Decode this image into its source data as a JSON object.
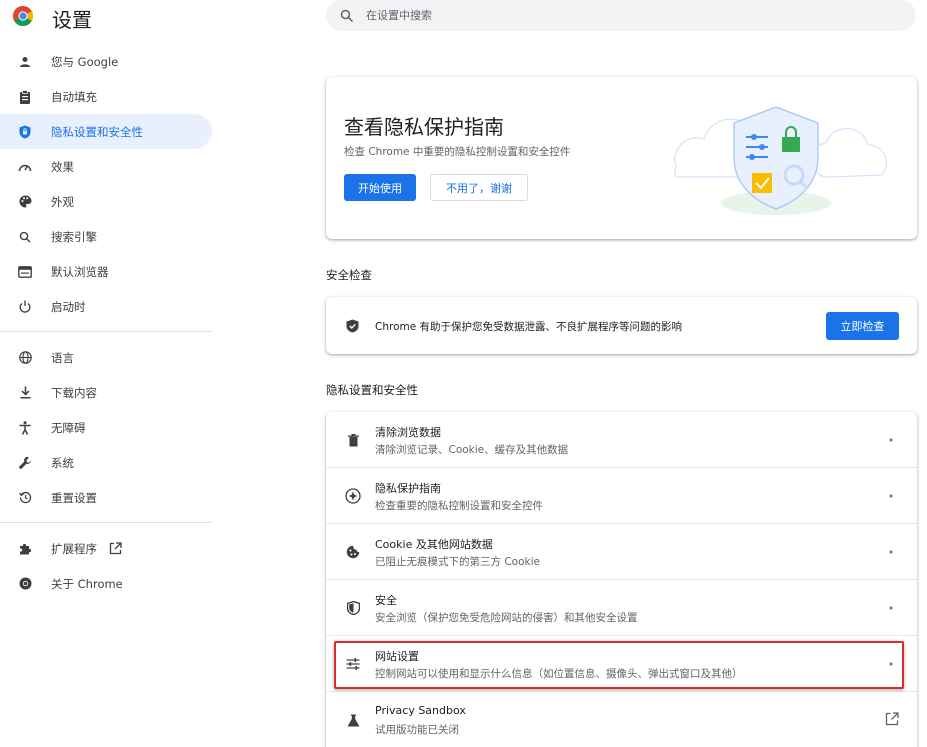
{
  "header": {
    "title": "设置",
    "search_placeholder": "在设置中搜索"
  },
  "sidebar": {
    "items": [
      {
        "label": "您与 Google",
        "icon": "person-icon"
      },
      {
        "label": "自动填充",
        "icon": "clipboard-icon"
      },
      {
        "label": "隐私设置和安全性",
        "icon": "shield-icon",
        "active": true
      },
      {
        "label": "效果",
        "icon": "speedometer-icon"
      },
      {
        "label": "外观",
        "icon": "palette-icon"
      },
      {
        "label": "搜索引擎",
        "icon": "search-icon"
      },
      {
        "label": "默认浏览器",
        "icon": "browser-window-icon"
      },
      {
        "label": "启动时",
        "icon": "power-icon"
      },
      {
        "label": "语言",
        "icon": "globe-icon"
      },
      {
        "label": "下载内容",
        "icon": "download-icon"
      },
      {
        "label": "无障碍",
        "icon": "accessibility-icon"
      },
      {
        "label": "系统",
        "icon": "wrench-icon"
      },
      {
        "label": "重置设置",
        "icon": "reset-history-icon"
      },
      {
        "label": "扩展程序",
        "icon": "puzzle-icon"
      },
      {
        "label": "关于 Chrome",
        "icon": "chrome-icon"
      }
    ]
  },
  "promo": {
    "title": "查看隐私保护指南",
    "subtitle": "检查 Chrome 中重要的隐私控制设置和安全控件",
    "primary_button": "开始使用",
    "secondary_button": "不用了，谢谢"
  },
  "safety_check": {
    "section_title": "安全检查",
    "text": "Chrome 有助于保护您免受数据泄露、不良扩展程序等问题的影响",
    "button": "立即检查"
  },
  "privacy": {
    "section_title": "隐私设置和安全性",
    "rows": [
      {
        "title": "清除浏览数据",
        "subtitle": "清除浏览记录、Cookie、缓存及其他数据",
        "icon": "trash-icon"
      },
      {
        "title": "隐私保护指南",
        "subtitle": "检查重要的隐私控制设置和安全控件",
        "icon": "compass-plus-icon"
      },
      {
        "title": "Cookie 及其他网站数据",
        "subtitle": "已阻止无痕模式下的第三方 Cookie",
        "icon": "cookie-icon"
      },
      {
        "title": "安全",
        "subtitle": "安全浏览（保护您免受危险网站的侵害）和其他安全设置",
        "icon": "shield-icon"
      },
      {
        "title": "网站设置",
        "subtitle": "控制网站可以使用和显示什么信息（如位置信息、摄像头、弹出式窗口及其他）",
        "icon": "sliders-icon",
        "highlighted": true
      },
      {
        "title": "Privacy Sandbox",
        "subtitle": "试用版功能已关闭",
        "icon": "flask-icon",
        "external": true
      }
    ]
  },
  "colors": {
    "accent": "#1a73e8",
    "active_bg": "#e8f0fe",
    "highlight_border": "#d32f2f"
  }
}
